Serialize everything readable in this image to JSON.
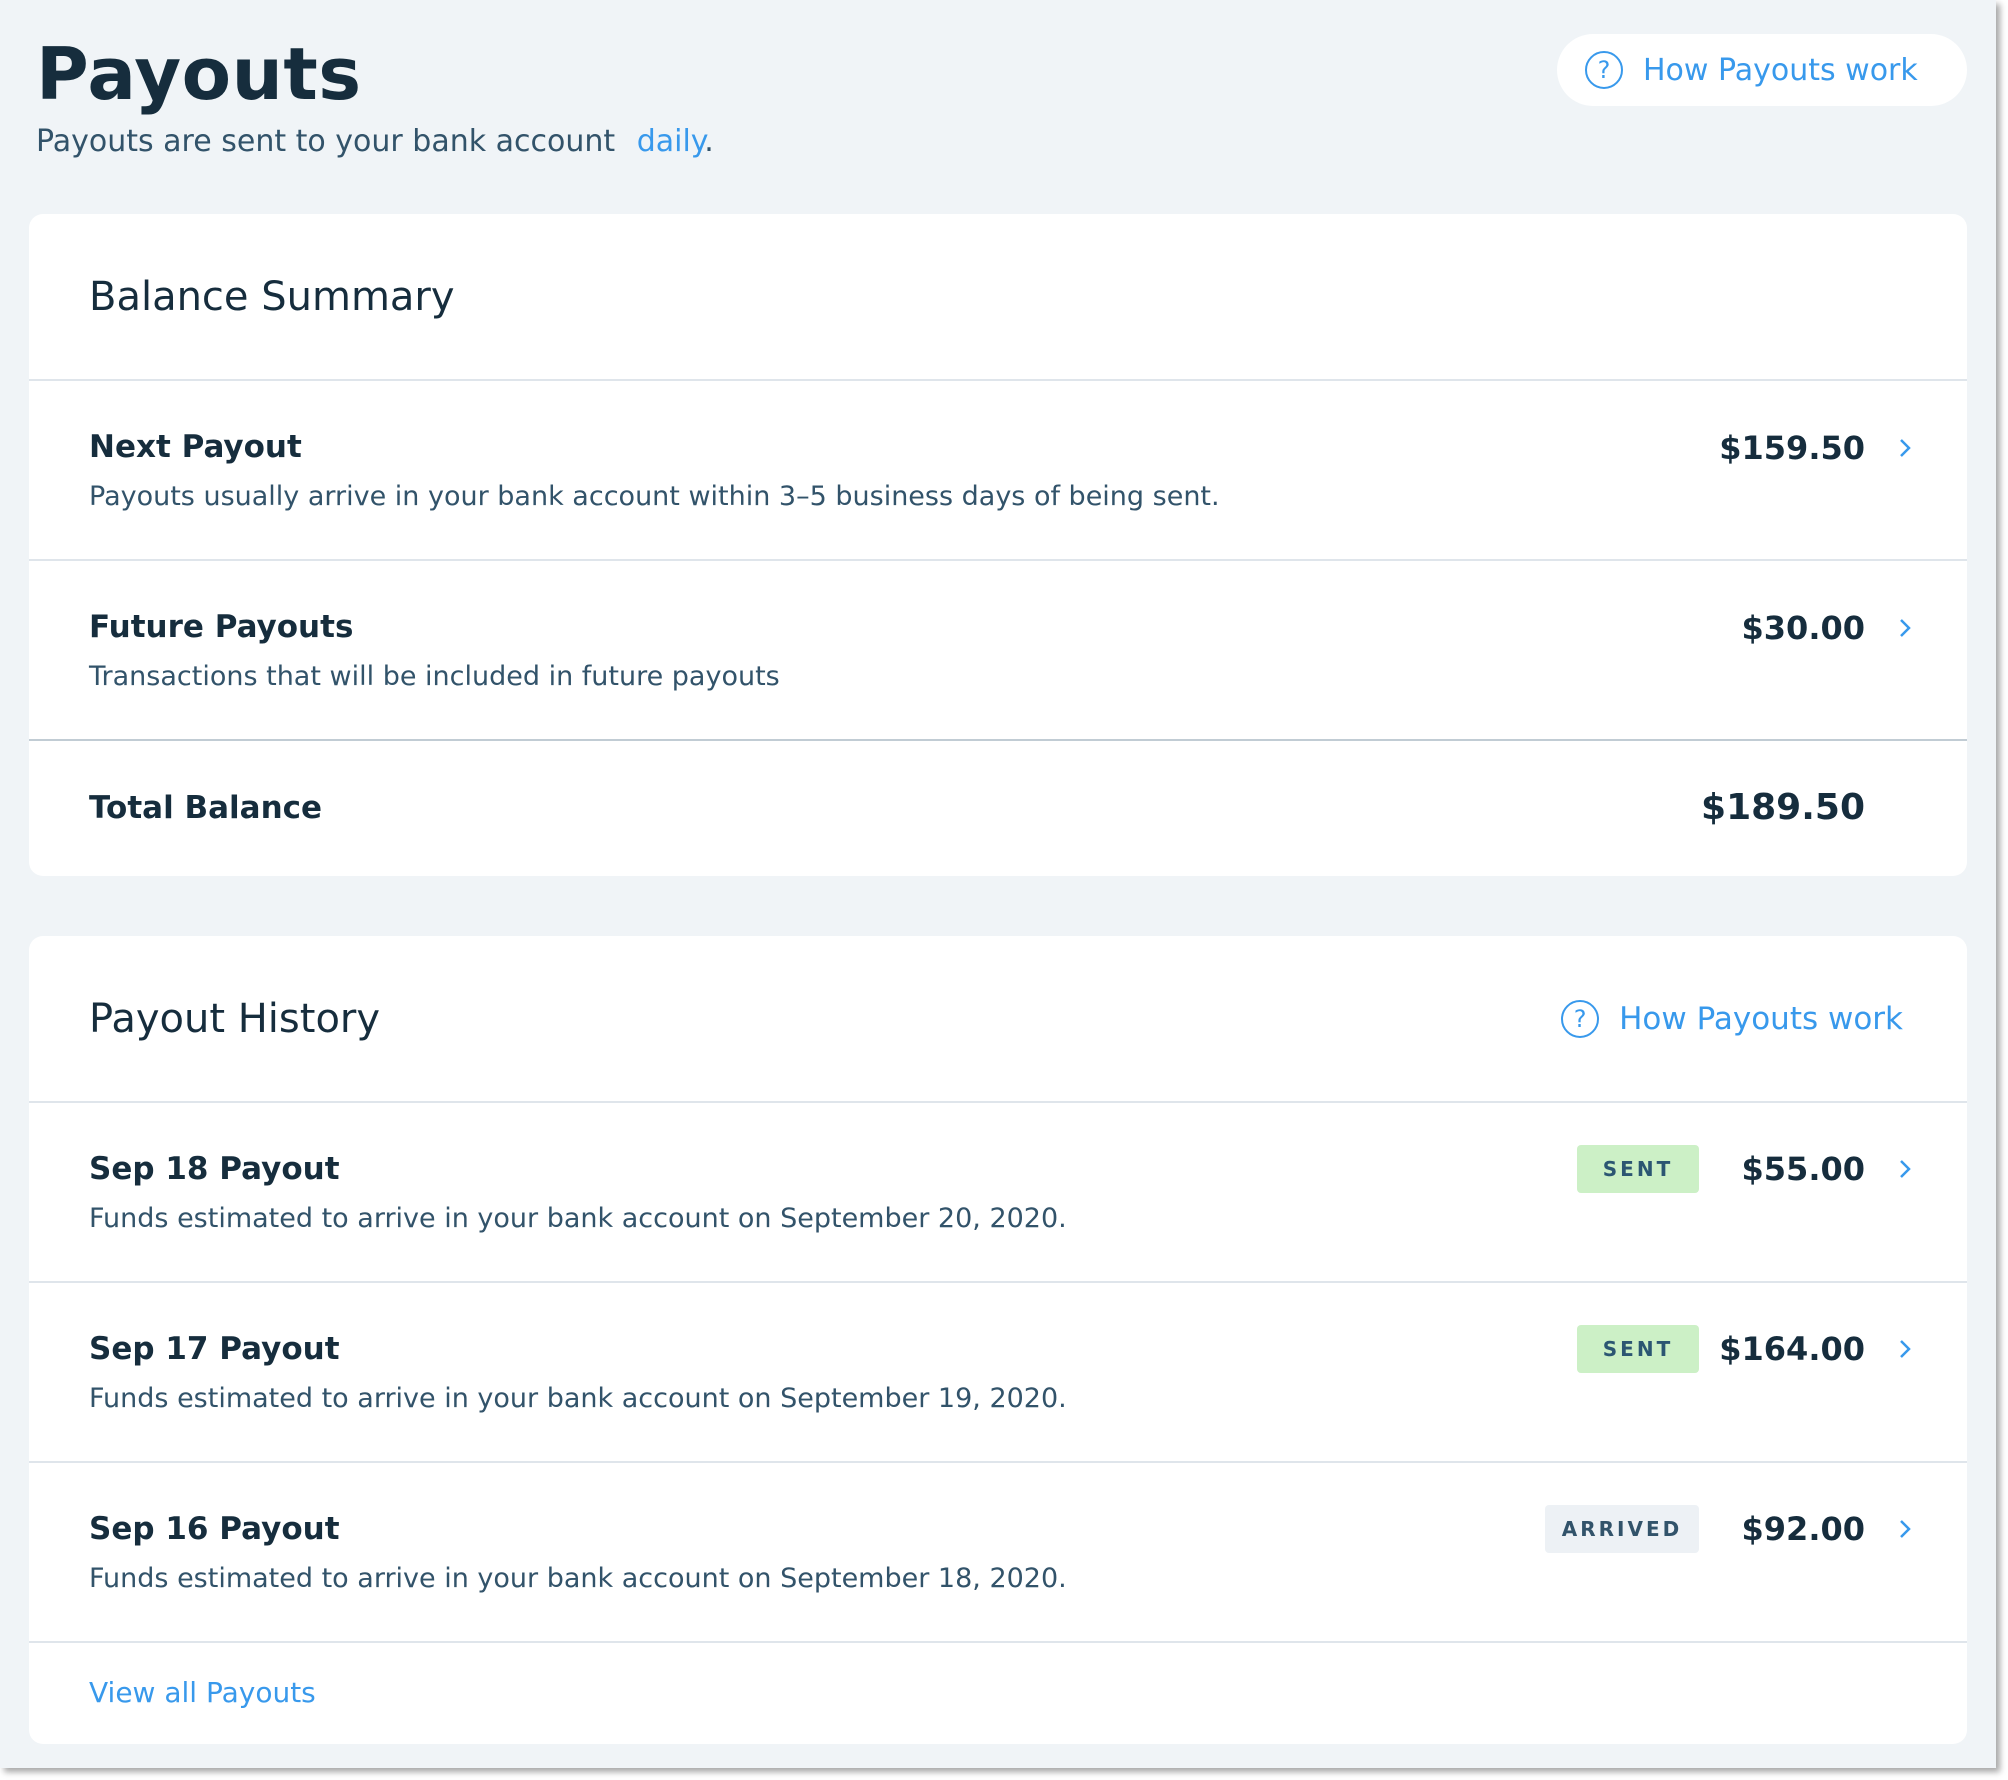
{
  "header": {
    "title": "Payouts",
    "subtitle_prefix": "Payouts are sent to your bank account",
    "subtitle_link": "daily",
    "subtitle_suffix": ".",
    "help_label": "How Payouts work"
  },
  "balance_summary": {
    "title": "Balance Summary",
    "rows": [
      {
        "name": "Next Payout",
        "description": "Payouts usually arrive in your bank account within 3–5 business days of being sent.",
        "amount": "$159.50"
      },
      {
        "name": "Future Payouts",
        "description": "Transactions that will be included in future payouts",
        "amount": "$30.00"
      }
    ],
    "total": {
      "name": "Total Balance",
      "amount": "$189.50"
    }
  },
  "payout_history": {
    "title": "Payout History",
    "help_label": "How Payouts work",
    "rows": [
      {
        "name": "Sep 18 Payout",
        "description": "Funds estimated to arrive in your bank account on September 20, 2020.",
        "status": "SENT",
        "amount": "$55.00"
      },
      {
        "name": "Sep 17 Payout",
        "description": "Funds estimated to arrive in your bank account on September 19, 2020.",
        "status": "SENT",
        "amount": "$164.00"
      },
      {
        "name": "Sep 16 Payout",
        "description": "Funds estimated to arrive in your bank account on September 18, 2020.",
        "status": "ARRIVED",
        "amount": "$92.00"
      }
    ],
    "view_all_label": "View all Payouts"
  },
  "icons": {
    "help": "question-circle-icon",
    "row_action": "chevron-right-icon"
  },
  "colors": {
    "accent": "#3899ec",
    "text": "#162d3d",
    "background": "#f0f4f7",
    "sent_badge": "#ccf0c6",
    "arrived_badge": "#edf1f5"
  }
}
